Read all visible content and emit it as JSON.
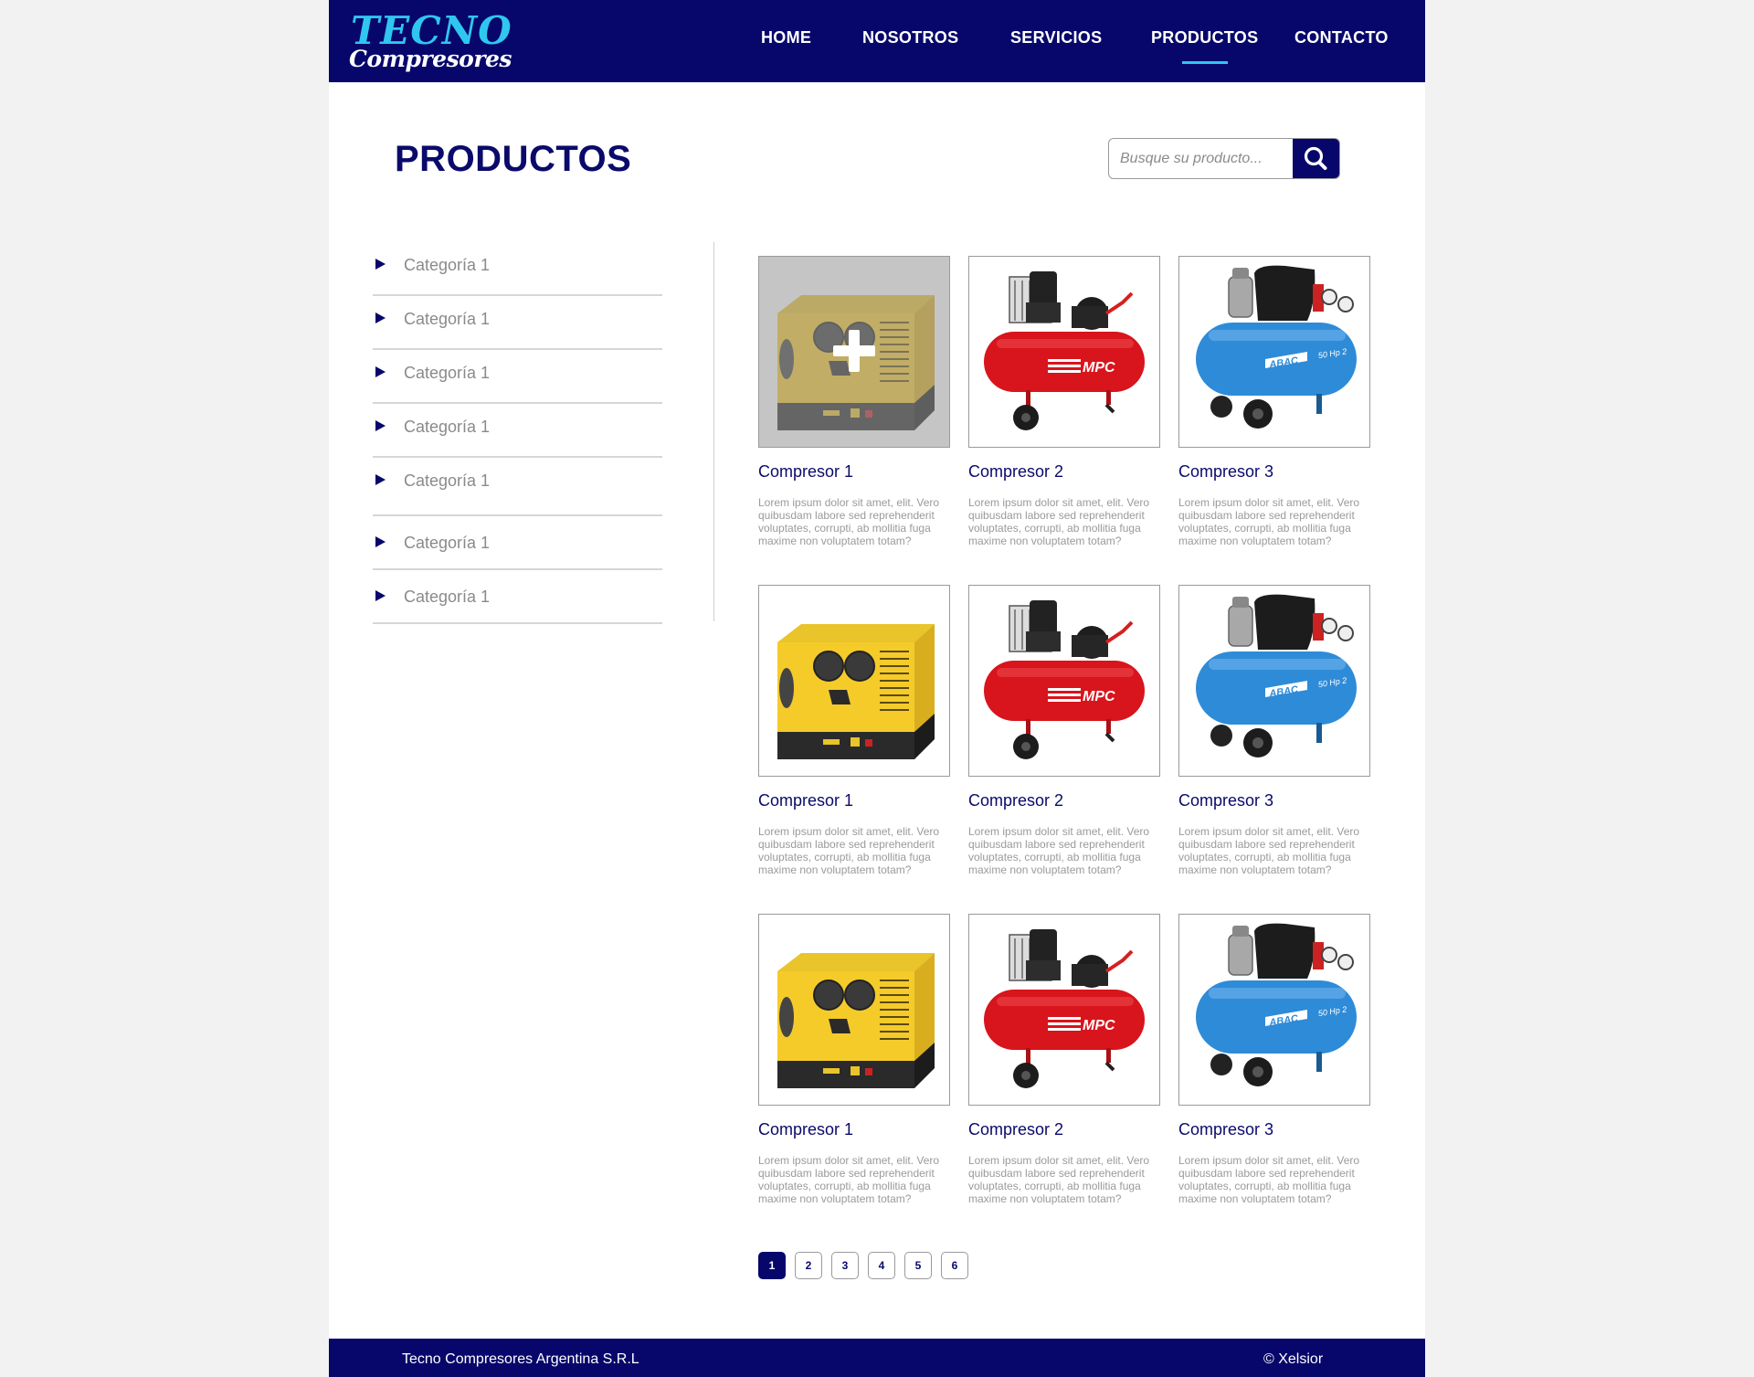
{
  "brand": {
    "logo_line1": "TECNO",
    "logo_line2": "Compresores",
    "color_primary": "#07076b",
    "color_accent": "#2fc6f0"
  },
  "nav": {
    "items": [
      {
        "label": "HOME"
      },
      {
        "label": "NOSOTROS"
      },
      {
        "label": "SERVICIOS"
      },
      {
        "label": "PRODUCTOS",
        "active": true
      },
      {
        "label": "CONTACTO"
      }
    ]
  },
  "main": {
    "title": "PRODUCTOS",
    "search": {
      "placeholder": "Busque su producto...",
      "button_icon": "search-icon"
    }
  },
  "sidebar": {
    "categories": [
      {
        "label": "Categoría 1"
      },
      {
        "label": "Categoría 1"
      },
      {
        "label": "Categoría 1"
      },
      {
        "label": "Categoría 1"
      },
      {
        "label": "Categoría 1"
      },
      {
        "label": "Categoría 1"
      },
      {
        "label": "Categoría 1"
      }
    ]
  },
  "products": [
    {
      "name": "Compresor 1",
      "desc": "Lorem ipsum dolor sit amet, elit. Vero quibusdam labore sed reprehenderit voluptates, corrupti, ab mollitia fuga maxime non voluptatem totam?",
      "image": "yellow-compressor",
      "hover": true
    },
    {
      "name": "Compresor 2",
      "desc": "Lorem ipsum dolor sit amet, elit. Vero quibusdam labore sed reprehenderit voluptates, corrupti, ab mollitia fuga maxime non voluptatem totam?",
      "image": "red-compressor",
      "brand_text": "MPC"
    },
    {
      "name": "Compresor 3",
      "desc": "Lorem ipsum dolor sit amet, elit. Vero quibusdam labore sed reprehenderit voluptates, corrupti, ab mollitia fuga maxime non voluptatem totam?",
      "image": "blue-compressor",
      "brand_text": "ABAC",
      "sub_text": "50 Hp 2"
    },
    {
      "name": "Compresor 1",
      "desc": "Lorem ipsum dolor sit amet, elit. Vero quibusdam labore sed reprehenderit voluptates, corrupti, ab mollitia fuga maxime non voluptatem totam?",
      "image": "yellow-compressor"
    },
    {
      "name": "Compresor 2",
      "desc": "Lorem ipsum dolor sit amet, elit. Vero quibusdam labore sed reprehenderit voluptates, corrupti, ab mollitia fuga maxime non voluptatem totam?",
      "image": "red-compressor",
      "brand_text": "MPC"
    },
    {
      "name": "Compresor 3",
      "desc": "Lorem ipsum dolor sit amet, elit. Vero quibusdam labore sed reprehenderit voluptates, corrupti, ab mollitia fuga maxime non voluptatem totam?",
      "image": "blue-compressor",
      "brand_text": "ABAC",
      "sub_text": "50 Hp 2"
    },
    {
      "name": "Compresor 1",
      "desc": "Lorem ipsum dolor sit amet, elit. Vero quibusdam labore sed reprehenderit voluptates, corrupti, ab mollitia fuga maxime non voluptatem totam?",
      "image": "yellow-compressor"
    },
    {
      "name": "Compresor 2",
      "desc": "Lorem ipsum dolor sit amet, elit. Vero quibusdam labore sed reprehenderit voluptates, corrupti, ab mollitia fuga maxime non voluptatem totam?",
      "image": "red-compressor",
      "brand_text": "MPC"
    },
    {
      "name": "Compresor 3",
      "desc": "Lorem ipsum dolor sit amet, elit. Vero quibusdam labore sed reprehenderit voluptates, corrupti, ab mollitia fuga maxime non voluptatem totam?",
      "image": "blue-compressor",
      "brand_text": "ABAC",
      "sub_text": "50 Hp 2"
    }
  ],
  "pagination": {
    "pages": [
      "1",
      "2",
      "3",
      "4",
      "5",
      "6"
    ],
    "current": "1"
  },
  "footer": {
    "company": "Tecno Compresores Argentina S.R.L",
    "credit": "© Xelsior"
  }
}
